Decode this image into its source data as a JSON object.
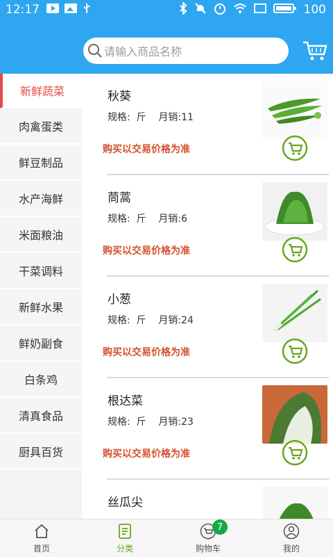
{
  "status": {
    "time": "12:17",
    "battery": "100"
  },
  "search": {
    "placeholder": "请输入商品名称"
  },
  "sidebar": {
    "items": [
      {
        "label": "新鲜蔬菜"
      },
      {
        "label": "肉禽蛋类"
      },
      {
        "label": "鲜豆制品"
      },
      {
        "label": "水产海鲜"
      },
      {
        "label": "米面粮油"
      },
      {
        "label": "干菜调料"
      },
      {
        "label": "新鲜水果"
      },
      {
        "label": "鲜奶副食"
      },
      {
        "label": "白条鸡"
      },
      {
        "label": "清真食品"
      },
      {
        "label": "厨具百货"
      }
    ]
  },
  "products": [
    {
      "name": "秋葵",
      "spec": "规格:  斤    月销:11",
      "note": "购买以交易价格为准"
    },
    {
      "name": "茼蒿",
      "spec": "规格:  斤    月销:6",
      "note": "购买以交易价格为准"
    },
    {
      "name": "小葱",
      "spec": "规格:  斤    月销:24",
      "note": "购买以交易价格为准"
    },
    {
      "name": "根达菜",
      "spec": "规格:  斤    月销:23",
      "note": "购买以交易价格为准"
    },
    {
      "name": "丝瓜尖",
      "spec": "",
      "note": ""
    }
  ],
  "tabs": [
    {
      "label": "首页"
    },
    {
      "label": "分类"
    },
    {
      "label": "购物车"
    },
    {
      "label": "我的"
    }
  ],
  "cart_badge": "7",
  "colors": {
    "header": "#2ea6f0",
    "accent_red": "#e44c4c",
    "price_note": "#d4512c",
    "green": "#69a51e"
  }
}
